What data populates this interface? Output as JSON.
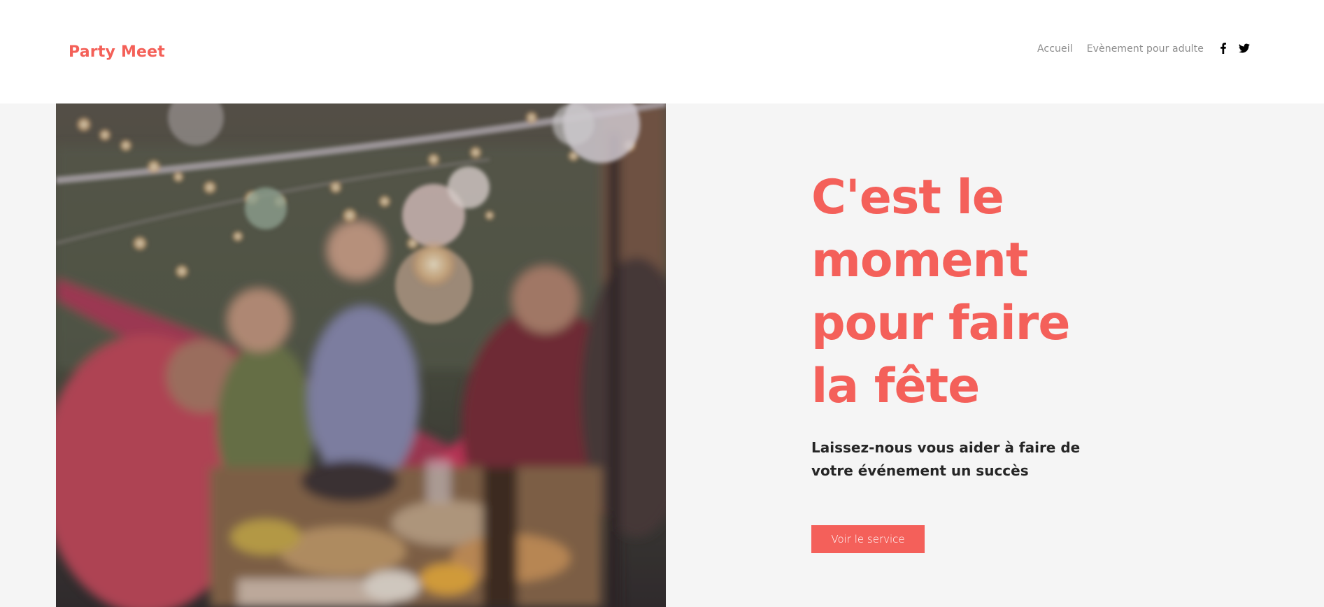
{
  "header": {
    "logo": "Party Meet",
    "nav": [
      "Accueil",
      "Evènement pour adulte"
    ],
    "social": [
      "facebook-icon",
      "twitter-icon"
    ]
  },
  "hero": {
    "headline_lines": [
      "C'est le",
      "moment",
      "pour faire",
      "la fête"
    ],
    "subtitle": "Laissez-nous vous aider à faire de votre événement un succès",
    "cta_label": "Voir le service",
    "image_description": "photo"
  },
  "colors": {
    "accent": "#f4605a",
    "background": "#f5f5f5",
    "nav_text": "#8d8d8d",
    "subtitle_text": "#262626"
  }
}
